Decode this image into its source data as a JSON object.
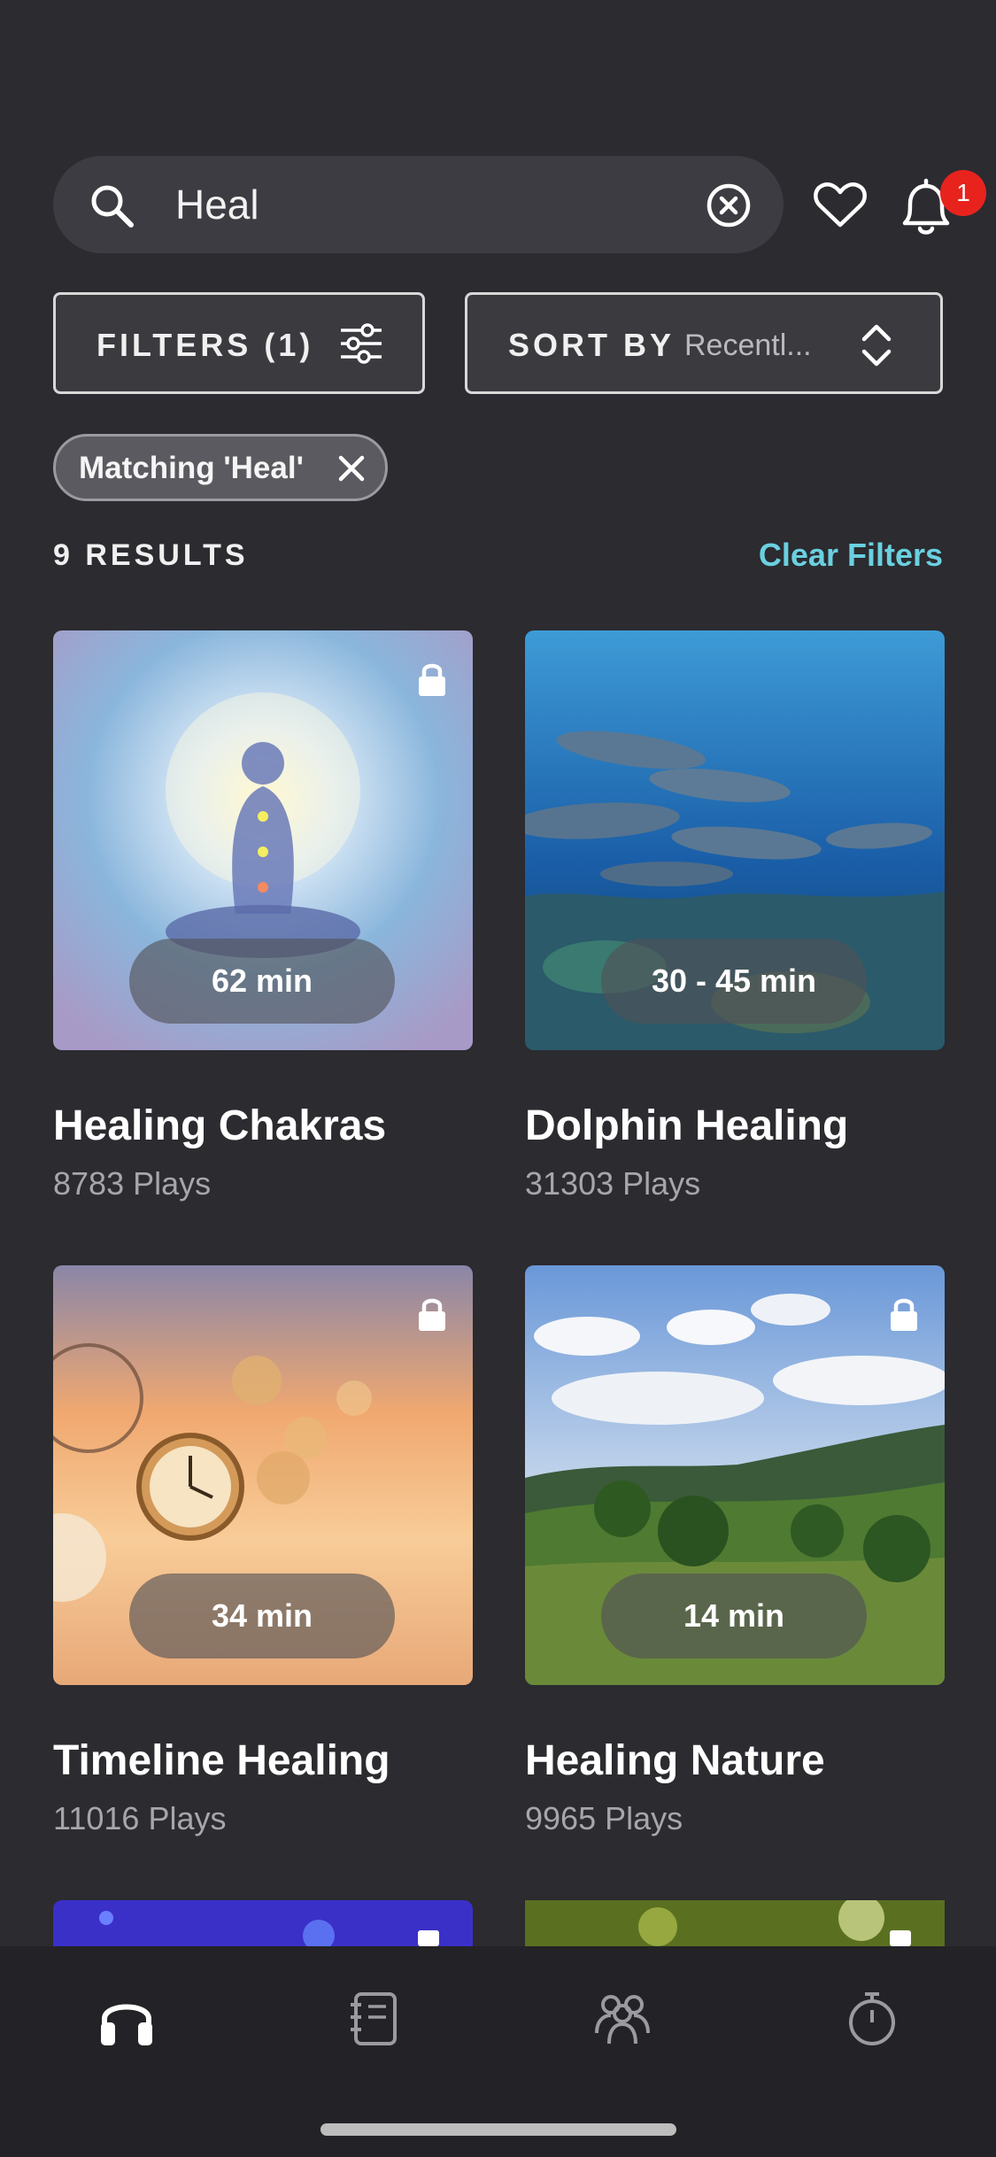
{
  "search": {
    "value": "Heal",
    "icons": {
      "search": "search-icon",
      "clear": "clear-circle-icon"
    }
  },
  "header": {
    "favorites_icon": "heart-icon",
    "notifications_icon": "bell-icon",
    "notification_count": "1",
    "badge_color": "#e8231e"
  },
  "filters": {
    "filters_label": "FILTERS (1)",
    "sort_label": "SORT BY",
    "sort_value": "Recentl...",
    "active_chip": "Matching 'Heal'"
  },
  "results": {
    "count_label": "9 RESULTS",
    "clear_filters_label": "Clear Filters",
    "accent_color": "#6ad0e0"
  },
  "cards": [
    {
      "title": "Healing Chakras",
      "plays": "8783 Plays",
      "duration": "62 min",
      "locked": true
    },
    {
      "title": "Dolphin Healing",
      "plays": "31303 Plays",
      "duration": "30 - 45 min",
      "locked": false
    },
    {
      "title": "Timeline Healing",
      "plays": "11016 Plays",
      "duration": "34 min",
      "locked": true
    },
    {
      "title": "Healing Nature",
      "plays": "9965 Plays",
      "duration": "14 min",
      "locked": true
    }
  ],
  "tabbar": {
    "tabs": [
      {
        "icon": "headphones-icon",
        "active": true
      },
      {
        "icon": "journal-icon",
        "active": false
      },
      {
        "icon": "community-icon",
        "active": false
      },
      {
        "icon": "timer-icon",
        "active": false
      }
    ]
  }
}
